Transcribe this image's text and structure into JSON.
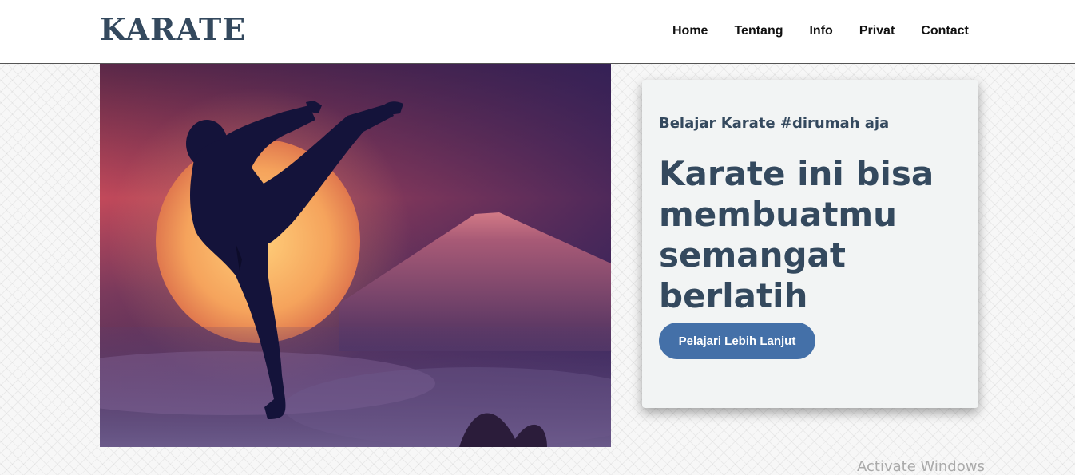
{
  "header": {
    "logo": "KARATE",
    "nav": [
      "Home",
      "Tentang",
      "Info",
      "Privat",
      "Contact"
    ]
  },
  "hero": {
    "image": "karate-kick-silhouette-sunset-mountain"
  },
  "card": {
    "subtitle": "Belajar Karate #dirumah aja",
    "headline": "Karate ini bisa membuatmu semangat berlatih",
    "cta": "Pelajari Lebih Lanjut"
  },
  "overlay": {
    "watermark": "Activate Windows"
  },
  "colors": {
    "brand": "#34495e",
    "button": "#4470a8",
    "card_bg": "#f2f4f4"
  }
}
